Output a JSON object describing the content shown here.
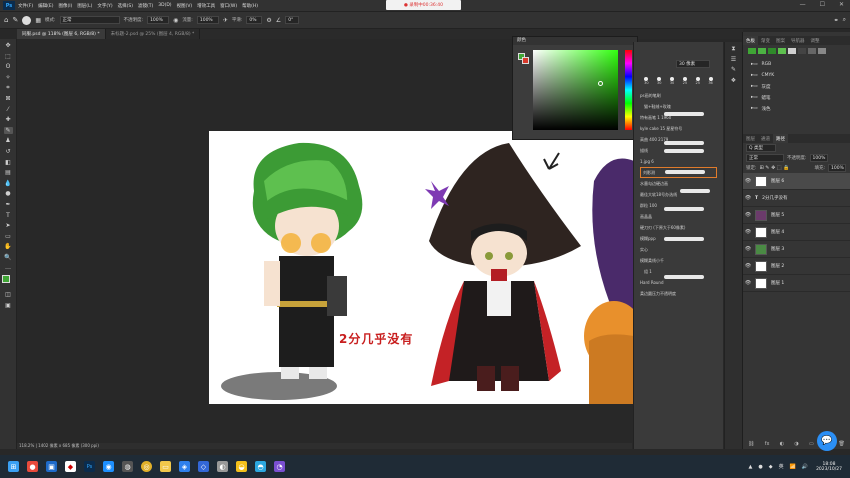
{
  "menubar": {
    "logo": "Ps",
    "items": [
      "文件(F)",
      "编辑(E)",
      "图像(I)",
      "图层(L)",
      "文字(Y)",
      "选择(S)",
      "滤镜(T)",
      "3D(D)",
      "视图(V)",
      "增效工具",
      "窗口(W)",
      "帮助(H)"
    ],
    "recording": "● 录制中00:36:40"
  },
  "options": {
    "mode_label": "模式:",
    "mode_value": "正常",
    "opacity_label": "不透明度:",
    "opacity_value": "100%",
    "flow_label": "流量:",
    "flow_value": "100%",
    "smooth_label": "平滑:",
    "smooth_value": "0%",
    "angle_value": "0°"
  },
  "tabs": [
    {
      "label": "同服.psd @ 118% (图层 6, RGB/8) *"
    },
    {
      "label": "未标题-2.psd @ 25% (图层 4, RGB/8) *"
    }
  ],
  "status": "118.2% | 1402 像素 x 685 像素 (300 ppi)",
  "canvas": {
    "caption": "2分几乎没有"
  },
  "color_panel": {
    "title": "颜色"
  },
  "brush_panel": {
    "size_label": "30 像素",
    "size_numbers": [
      "30",
      "30",
      "30",
      "25",
      "25",
      "36"
    ],
    "items": [
      "ps画的笔刷",
      "猫+鞋绒+玫瑰",
      "特有画笔 1 1960",
      "kyle cake 15 星星符号",
      "高曲 400 2179",
      "描线",
      "1.jpg 6",
      "刘影测",
      "水墨勾边硬边画",
      "最佳大软18号办选线",
      "群粒 100",
      "画晶晶",
      "硬刀刃 (下原大于60像素)",
      "模糊ppp",
      "实心",
      "模糊柔线小千",
      "组 1",
      "Hard Round",
      "柔边圆压力不透明度"
    ]
  },
  "right_panel": {
    "swatch_tabs": [
      "色板",
      "渐变",
      "图案",
      "导航器",
      "调整"
    ],
    "swatch_folders": [
      "RGB",
      "CMYK",
      "灰度",
      "蜡笔",
      "浅色"
    ],
    "layer_tabs": [
      "图层",
      "通道",
      "路径"
    ],
    "filter_label": "Q 类型",
    "blend_mode": "正常",
    "opacity_label": "不透明度:",
    "opacity_value": "100%",
    "lock_label": "锁定:",
    "fill_label": "填充:",
    "fill_value": "100%",
    "layers": [
      "图层 6",
      "2分几乎没有",
      "图层 5",
      "图层 4",
      "图层 3",
      "图层 2",
      "图层 1"
    ]
  },
  "taskbar": {
    "time": "18:08",
    "date": "2023/10/27",
    "lang": "英"
  },
  "colors": {
    "foreground": "#3fa535",
    "background": "#d8392b",
    "picker_hue": "#32ff10"
  }
}
